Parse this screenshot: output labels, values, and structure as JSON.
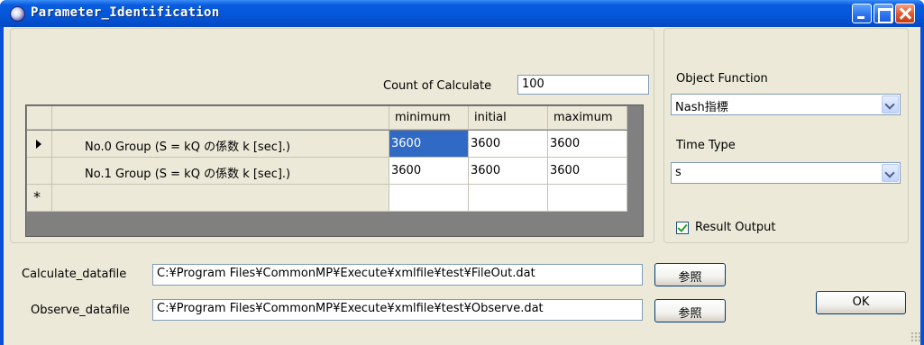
{
  "window": {
    "title": "Parameter_Identification"
  },
  "calc": {
    "count_label": "Count of Calculate",
    "count_value": "100"
  },
  "grid": {
    "columns": [
      "minimum",
      "initial",
      "maximum"
    ],
    "rows": [
      {
        "label": "No.0 Group (S = kQ の係数 k [sec].)",
        "values": [
          "3600",
          "3600",
          "3600"
        ],
        "current": true
      },
      {
        "label": "No.1 Group (S = kQ の係数 k [sec].)",
        "values": [
          "3600",
          "3600",
          "3600"
        ],
        "current": false
      }
    ],
    "new_row_marker": "*",
    "selected_cell": "minimum of No.0 Group"
  },
  "object_function": {
    "label": "Object Function",
    "selected": "Nash指標"
  },
  "time_type": {
    "label": "Time Type",
    "selected": "s"
  },
  "result_output": {
    "label": "Result Output",
    "checked": true
  },
  "files": {
    "calculate_label": "Calculate_datafile",
    "calculate_path": "C:¥Program Files¥CommonMP¥Execute¥xmlfile¥test¥FileOut.dat",
    "observe_label": "Observe_datafile",
    "observe_path": "C:¥Program Files¥CommonMP¥Execute¥xmlfile¥test¥Observe.dat",
    "browse_label": "参照"
  },
  "buttons": {
    "ok": "OK"
  },
  "colors": {
    "titlebar": "#0a5ce0",
    "selection": "#316ac5",
    "dialog_bg": "#ece9d8"
  }
}
